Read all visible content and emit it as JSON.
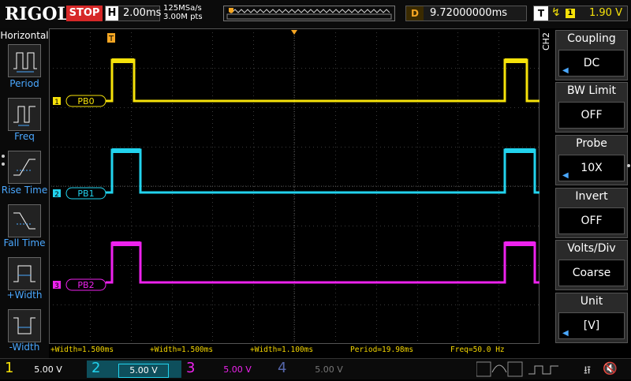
{
  "topbar": {
    "logo": "RIGOL",
    "run_state": "STOP",
    "timebase_key": "H",
    "timebase": "2.00ms",
    "sample_rate": "125MSa/s",
    "mem_depth": "3.00M pts",
    "delay_key": "D",
    "delay": "9.72000000ms",
    "trigger_key": "T",
    "trigger_source": "1",
    "trigger_level": "1.90 V"
  },
  "left_panel": {
    "title": "Horizontal",
    "items": [
      {
        "label": "Period"
      },
      {
        "label": "Freq"
      },
      {
        "label": "Rise Time"
      },
      {
        "label": "Fall Time"
      },
      {
        "label": "+Width"
      },
      {
        "label": "-Width"
      }
    ]
  },
  "channels": [
    {
      "id": "1",
      "label": "PB0",
      "color": "#f6e20a",
      "scale": "5.00 V"
    },
    {
      "id": "2",
      "label": "PB1",
      "color": "#22d3ee",
      "scale": "5.00 V"
    },
    {
      "id": "3",
      "label": "PB2",
      "color": "#ee22ee",
      "scale": "5.00 V"
    },
    {
      "id": "4",
      "label": "",
      "color": "#5566aa",
      "scale": "5.00 V"
    }
  ],
  "right_panel": {
    "channel_tag": "CH2",
    "menus": [
      {
        "title": "Coupling",
        "value": "DC"
      },
      {
        "title": "BW Limit",
        "value": "OFF"
      },
      {
        "title": "Probe",
        "value": "10X"
      },
      {
        "title": "Invert",
        "value": "OFF"
      },
      {
        "title": "Volts/Div",
        "value": "Coarse"
      },
      {
        "title": "Unit",
        "value": "[V]"
      }
    ]
  },
  "measurements": [
    "+Width=1.500ms",
    "+Width=1.500ms",
    "+Width=1.100ms",
    "Period=19.98ms",
    "Freq=50.0 Hz"
  ],
  "trigger_marker": "T",
  "colors": {
    "accent_blue": "#4aa8ff",
    "grid": "#3a3a3a",
    "trigger_orange": "#f5a623"
  }
}
